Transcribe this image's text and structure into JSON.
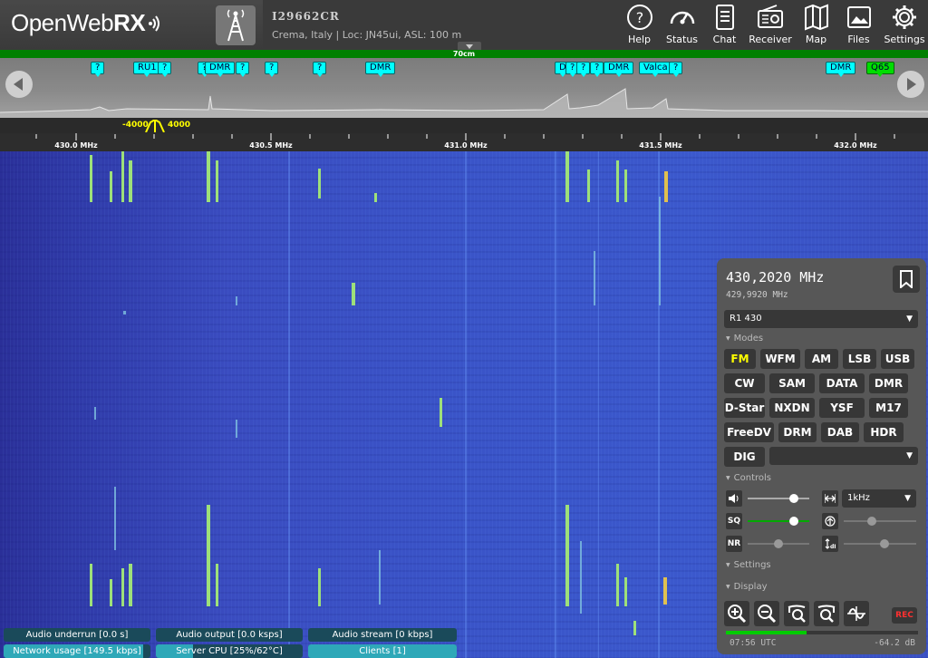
{
  "header": {
    "logo_text": "OpenWeb",
    "logo_bold": "RX",
    "receiver_name": "I29662CR",
    "receiver_desc": "Crema, Italy | Loc: JN45ui, ASL: 100 m",
    "nav": [
      {
        "label": "Help",
        "icon": "help-icon"
      },
      {
        "label": "Status",
        "icon": "gauge-icon"
      },
      {
        "label": "Chat",
        "icon": "document-icon"
      },
      {
        "label": "Receiver",
        "icon": "radio-icon"
      },
      {
        "label": "Map",
        "icon": "map-icon"
      },
      {
        "label": "Files",
        "icon": "image-icon"
      },
      {
        "label": "Settings",
        "icon": "gear-icon"
      }
    ]
  },
  "band": {
    "name": "70cm"
  },
  "bookmarks": [
    "?",
    "RU1",
    "?",
    "?",
    "DMR",
    "?",
    "?",
    "?",
    "?",
    "DMR",
    "D",
    "?",
    "?",
    "?",
    "DMR",
    "Valca",
    "?",
    "DMR",
    "Q65"
  ],
  "passband": {
    "low": "-4000",
    "high": "4000"
  },
  "scale": {
    "labels": [
      "430.0 MHz",
      "430.5 MHz",
      "431.0 MHz",
      "431.5 MHz",
      "432.0 MHz"
    ]
  },
  "status": {
    "audio_underrun": "Audio underrun [0.0 s]",
    "audio_output": "Audio output [0.0 ksps]",
    "audio_stream": "Audio stream [0 kbps]",
    "network_usage": "Network usage [149.5 kbps]",
    "server_cpu": "Server CPU [25%/62°C]",
    "clients": "Clients [1]",
    "cpu_load": 0.25,
    "network_load": 0.95,
    "clients_load": 1.0
  },
  "panel": {
    "frequency": "430,2020 MHz",
    "offset_frequency": "429,9920 MHz",
    "profile": "R1 430",
    "modes_label": "Modes",
    "modes": [
      "FM",
      "WFM",
      "AM",
      "LSB",
      "USB",
      "CW",
      "SAM",
      "DATA",
      "DMR",
      "D-Star",
      "NXDN",
      "YSF",
      "M17",
      "FreeDV",
      "DRM",
      "DAB",
      "HDR"
    ],
    "active_mode": "FM",
    "dig_label": "DIG",
    "controls_label": "Controls",
    "step": "1kHz",
    "sq_label": "SQ",
    "nr_label": "NR",
    "settings_label": "Settings",
    "display_label": "Display",
    "rec_label": "REC",
    "volume": 0.75,
    "squelch": 0.75,
    "nr_level": 0.5,
    "smeter_level": 0.42,
    "clock": "07:56 UTC",
    "db_level": "-64.2 dB"
  }
}
